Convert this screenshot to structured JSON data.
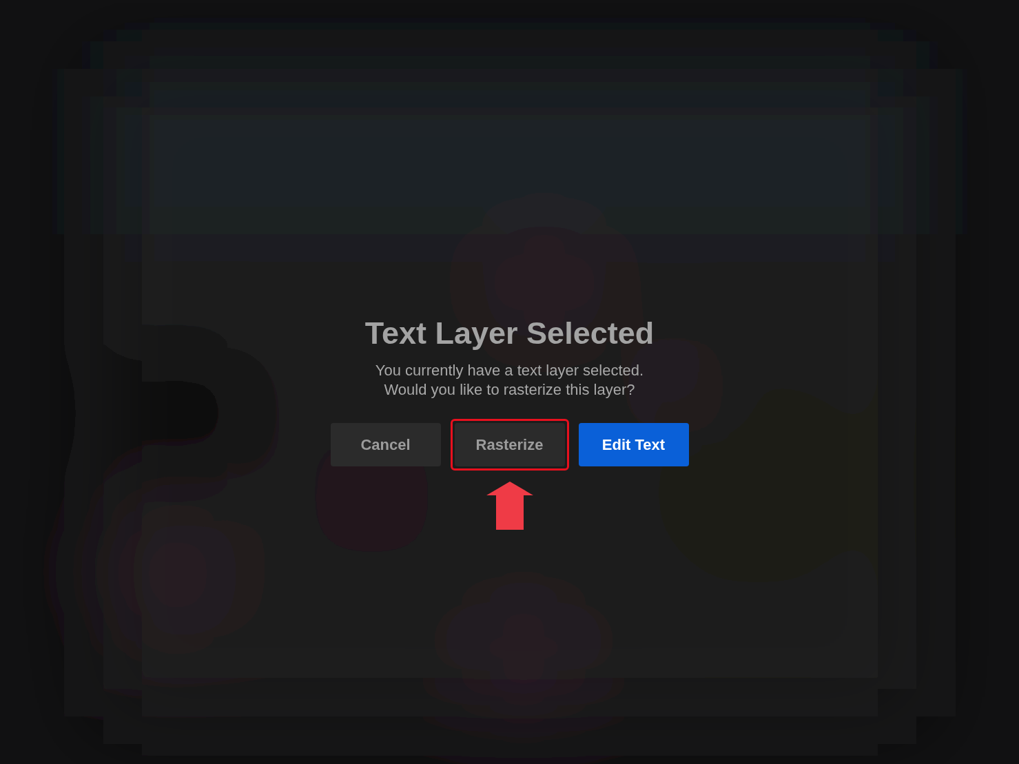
{
  "dialog": {
    "title": "Text Layer Selected",
    "message": [
      "You currently have a text layer selected.",
      "Would you like to rasterize this layer?"
    ],
    "buttons": [
      {
        "label": "Cancel",
        "kind": "secondary",
        "highlighted": false
      },
      {
        "label": "Rasterize",
        "kind": "secondary",
        "highlighted": true
      },
      {
        "label": "Edit Text",
        "kind": "primary",
        "highlighted": false
      }
    ]
  }
}
